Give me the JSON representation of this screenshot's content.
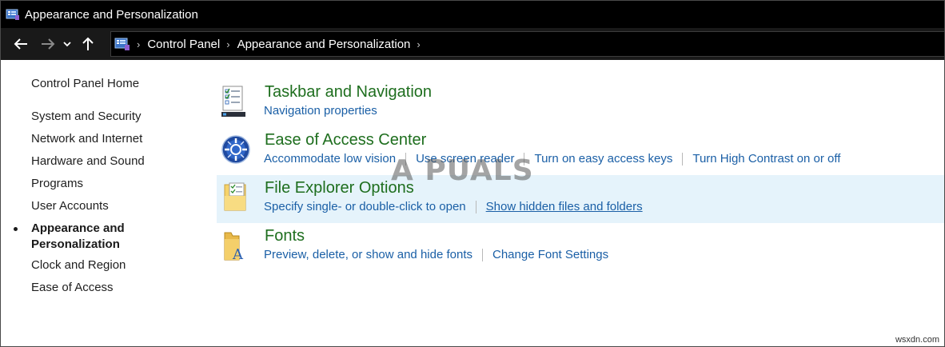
{
  "window": {
    "title": "Appearance and Personalization"
  },
  "nav": {
    "breadcrumb": [
      "Control Panel",
      "Appearance and Personalization"
    ]
  },
  "sidebar": {
    "items": [
      {
        "label": "Control Panel Home"
      },
      {
        "label": "System and Security"
      },
      {
        "label": "Network and Internet"
      },
      {
        "label": "Hardware and Sound"
      },
      {
        "label": "Programs"
      },
      {
        "label": "User Accounts"
      },
      {
        "label": "Appearance and Personalization",
        "line1": "Appearance and",
        "line2": "Personalization",
        "current": true
      },
      {
        "label": "Clock and Region"
      },
      {
        "label": "Ease of Access"
      }
    ]
  },
  "categories": [
    {
      "title": "Taskbar and Navigation",
      "icon": "taskbar-checklist-icon",
      "links": [
        "Navigation properties"
      ]
    },
    {
      "title": "Ease of Access Center",
      "icon": "ease-of-access-icon",
      "links": [
        "Accommodate low vision",
        "Use screen reader",
        "Turn on easy access keys",
        "Turn High Contrast on or off"
      ]
    },
    {
      "title": "File Explorer Options",
      "icon": "folder-options-icon",
      "links": [
        "Specify single- or double-click to open",
        "Show hidden files and folders"
      ]
    },
    {
      "title": "Fonts",
      "icon": "fonts-folder-icon",
      "links": [
        "Preview, delete, or show and hide fonts",
        "Change Font Settings"
      ]
    }
  ],
  "watermark": {
    "text": "A PUALS",
    "site": "wsxdn.com"
  },
  "colors": {
    "title_green": "#1e6e1e",
    "link_blue": "#1a5fa6",
    "hover_bg": "#e5f3fb"
  }
}
